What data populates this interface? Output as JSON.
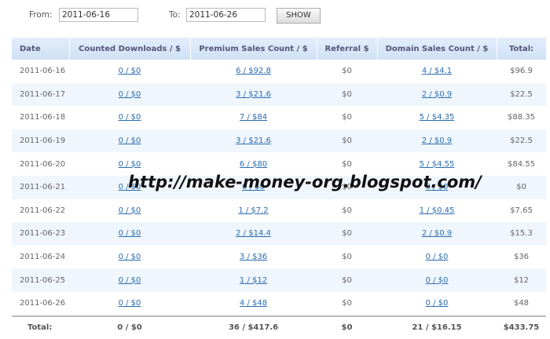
{
  "filter": {
    "from_label": "From:",
    "from_value": "2011-06-16",
    "to_label": "To:",
    "to_value": "2011-06-26",
    "show_label": "SHOW"
  },
  "columns": [
    "Date",
    "Counted Downloads / $",
    "Premium Sales Count / $",
    "Referral $",
    "Domain Sales Count / $",
    "Total:"
  ],
  "rows": [
    [
      "2011-06-16",
      "0 / $0",
      "6 / $92.8",
      "$0",
      "4 / $4.1",
      "$96.9"
    ],
    [
      "2011-06-17",
      "0 / $0",
      "3 / $21.6",
      "$0",
      "2 / $0.9",
      "$22.5"
    ],
    [
      "2011-06-18",
      "0 / $0",
      "7 / $84",
      "$0",
      "5 / $4.35",
      "$88.35"
    ],
    [
      "2011-06-19",
      "0 / $0",
      "3 / $21.6",
      "$0",
      "2 / $0.9",
      "$22.5"
    ],
    [
      "2011-06-20",
      "0 / $0",
      "6 / $80",
      "$0",
      "5 / $4.55",
      "$84.55"
    ],
    [
      "2011-06-21",
      "0 / $0",
      "0 / $0",
      "$0",
      "0 / $0",
      "$0"
    ],
    [
      "2011-06-22",
      "0 / $0",
      "1 / $7.2",
      "$0",
      "1 / $0.45",
      "$7.65"
    ],
    [
      "2011-06-23",
      "0 / $0",
      "2 / $14.4",
      "$0",
      "2 / $0.9",
      "$15.3"
    ],
    [
      "2011-06-24",
      "0 / $0",
      "3 / $36",
      "$0",
      "0 / $0",
      "$36"
    ],
    [
      "2011-06-25",
      "0 / $0",
      "1 / $12",
      "$0",
      "0 / $0",
      "$12"
    ],
    [
      "2011-06-26",
      "0 / $0",
      "4 / $48",
      "$0",
      "0 / $0",
      "$48"
    ]
  ],
  "totals": [
    "Total:",
    "0 / $0",
    "36 / $417.6",
    "$0",
    "21 / $16.15",
    "$433.75"
  ],
  "watermark": "http://make-money-org.blogspot.com/"
}
